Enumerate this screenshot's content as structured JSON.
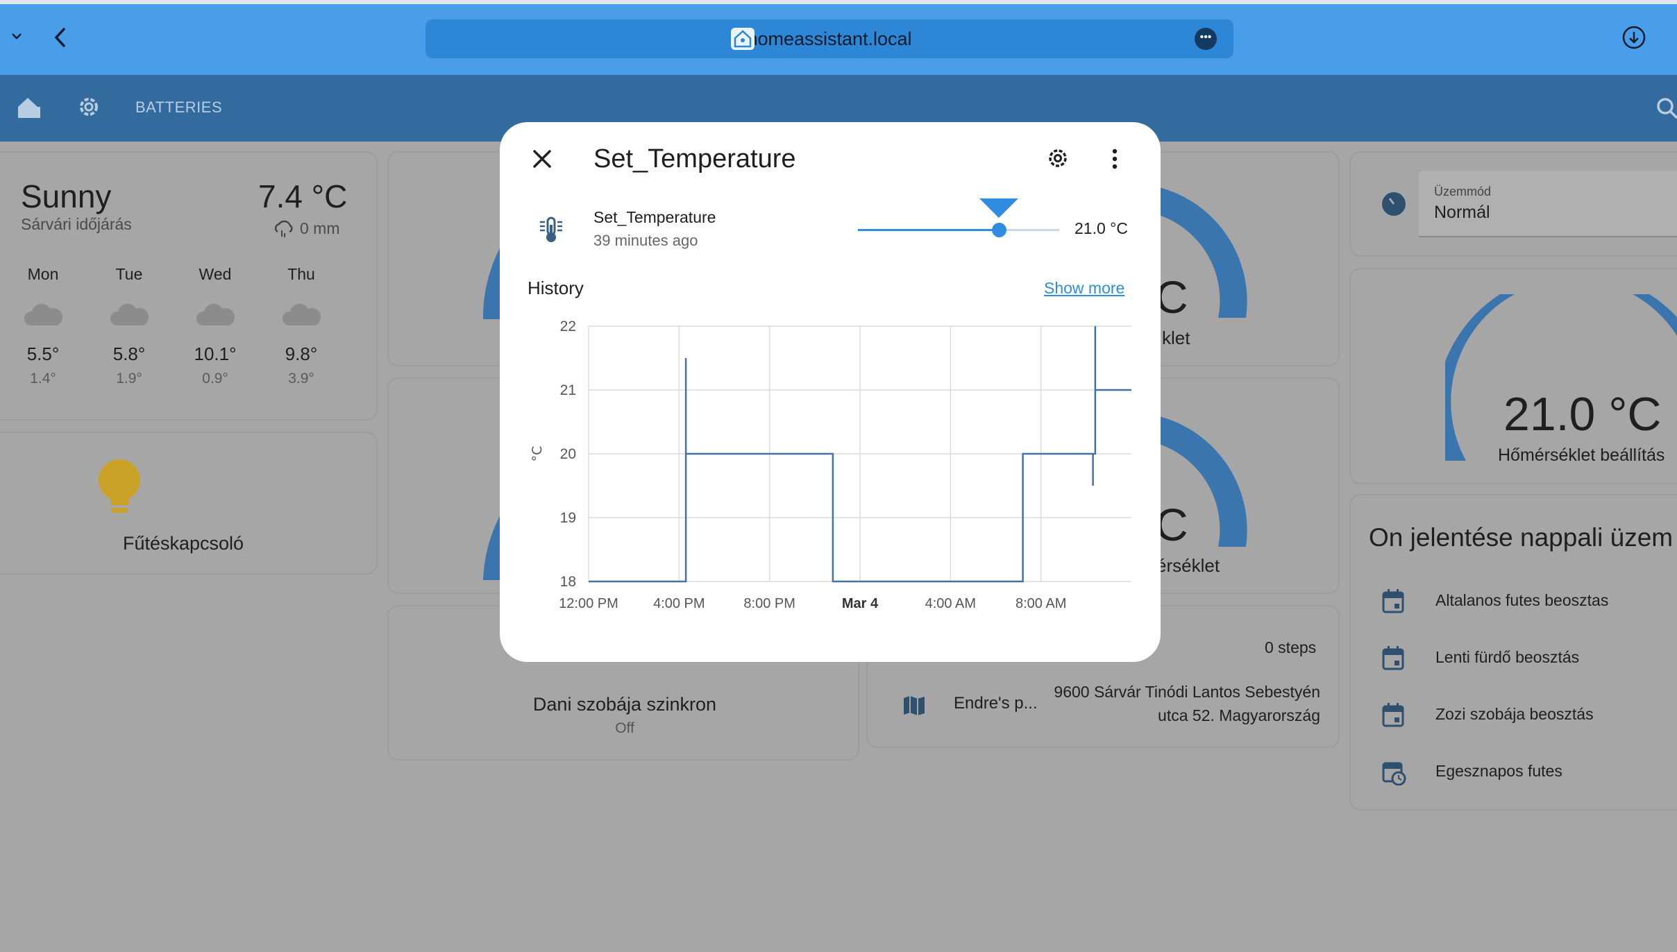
{
  "browser": {
    "url": "homeassistant.local"
  },
  "header": {
    "tab_label": "BATTERIES"
  },
  "weather": {
    "condition": "Sunny",
    "location": "Sárvári időjárás",
    "temperature": "7.4 °C",
    "precip": "0 mm",
    "forecast": [
      {
        "day": "Mon",
        "high": "5.5°",
        "low": "1.4°"
      },
      {
        "day": "Tue",
        "high": "5.8°",
        "low": "1.9°"
      },
      {
        "day": "Wed",
        "high": "10.1°",
        "low": "0.9°"
      },
      {
        "day": "Thu",
        "high": "9.8°",
        "low": "3.9°"
      }
    ]
  },
  "switch_card": {
    "label": "Fűtéskapcsoló"
  },
  "sync_card": {
    "name": "Dani szobája szinkron",
    "state": "Off"
  },
  "person_card": {
    "steps": "0 steps",
    "name": "Endre's p...",
    "address_line1": "9600 Sárvár Tinódi Lantos Sebestyén",
    "address_line2": "utca 52. Magyarország"
  },
  "gauges": {
    "label_top": "klet",
    "label_bottom": "érséklet",
    "c_fragment": "C"
  },
  "mode_card": {
    "label": "Üzemmód",
    "value": "Normál"
  },
  "thermo_card": {
    "value": "21.0 °C",
    "label": "Hőmérséklet beállítás"
  },
  "schedule_card": {
    "title": "On jelentése nappali üzem",
    "items": [
      "Altalanos futes beosztas",
      "Lenti fürdő beosztás",
      "Zozi szobája beosztás",
      "Egesznapos futes"
    ]
  },
  "modal": {
    "title": "Set_Temperature",
    "entity_name": "Set_Temperature",
    "last_changed": "39 minutes ago",
    "value_display": "21.0 °C",
    "slider_fraction": 0.7,
    "history_label": "History",
    "show_more": "Show more"
  },
  "chart_data": {
    "type": "line",
    "ylabel": "°C",
    "ylim": [
      18,
      22
    ],
    "yticks": [
      18,
      19,
      20,
      21,
      22
    ],
    "xlim": [
      0,
      24
    ],
    "xticks": [
      {
        "x": 0,
        "label": "12:00 PM",
        "bold": false
      },
      {
        "x": 4,
        "label": "4:00 PM",
        "bold": false
      },
      {
        "x": 8,
        "label": "8:00 PM",
        "bold": false
      },
      {
        "x": 12,
        "label": "Mar 4",
        "bold": true
      },
      {
        "x": 16,
        "label": "4:00 AM",
        "bold": false
      },
      {
        "x": 20,
        "label": "8:00 AM",
        "bold": false
      }
    ],
    "color": "#4471a6",
    "series": [
      {
        "x": [
          0,
          4.3,
          4.3,
          4.3,
          4.3,
          10.8,
          10.8,
          19.2,
          19.2,
          22.3,
          22.3,
          22.3,
          22.4,
          22.4,
          22.4,
          22.4,
          22.4,
          24
        ],
        "y": [
          18,
          18,
          21.5,
          19.5,
          20,
          20,
          18,
          18,
          20,
          20,
          19.5,
          20,
          20,
          22,
          20.5,
          21,
          21,
          21
        ]
      }
    ]
  }
}
